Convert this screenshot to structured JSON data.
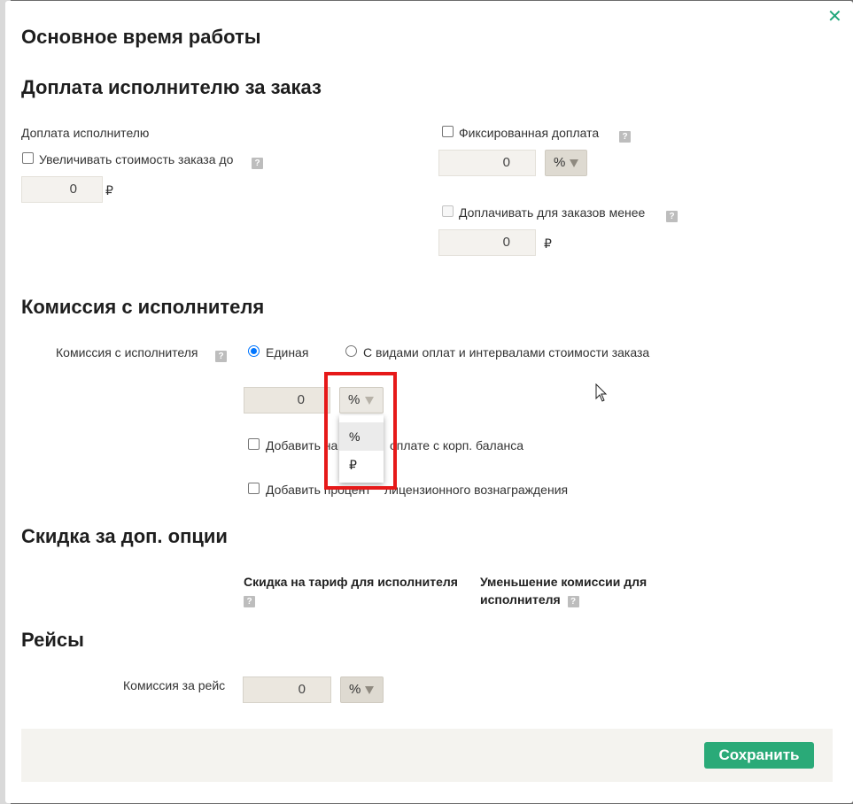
{
  "modal": {
    "title": "Основное время работы",
    "close_label": "✕"
  },
  "surcharge": {
    "heading": "Доплата исполнителю за заказ",
    "left_label": "Доплата исполнителю",
    "increase_cost_label": "Увеличивать стоимость заказа до",
    "increase_cost_value": "0",
    "increase_cost_unit": "₽",
    "fixed_label": "Фиксированная доплата",
    "fixed_value": "0",
    "fixed_unit_select": "%",
    "less_than_label": "Доплачивать для заказов менее",
    "less_than_value": "0",
    "less_than_unit": "₽",
    "help": "?"
  },
  "commission": {
    "heading": "Комиссия с исполнителя",
    "row_label": "Комиссия с исполнителя",
    "radio_single": "Единая",
    "radio_by_types": "С видами оплат и интервалами стоимости заказа",
    "value": "0",
    "unit_select": "%",
    "dropdown_options": [
      "%",
      "₽"
    ],
    "corp_balance_text_left": "Добавить на",
    "corp_balance_text_right": "оплате с корп. баланса",
    "license_text_left": "Добавить процент",
    "license_text_right": "лицензионного вознаграждения"
  },
  "discount": {
    "heading": "Скидка за доп. опции",
    "col1": "Скидка на тариф для исполнителя",
    "col2": "Уменьшение комиссии для исполнителя"
  },
  "trips": {
    "heading": "Рейсы",
    "row_label": "Комиссия за рейс",
    "value": "0",
    "unit_select": "%"
  },
  "footer": {
    "save_label": "Сохранить"
  },
  "colors": {
    "accent": "#2aaa78",
    "highlight": "#e61919",
    "radio": "#0075ff"
  }
}
